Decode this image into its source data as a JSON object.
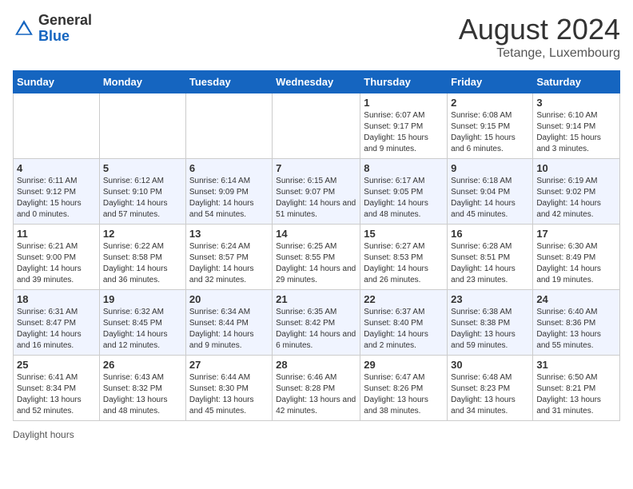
{
  "header": {
    "logo_general": "General",
    "logo_blue": "Blue",
    "month_title": "August 2024",
    "location": "Tetange, Luxembourg"
  },
  "footer": {
    "daylight_label": "Daylight hours"
  },
  "days_of_week": [
    "Sunday",
    "Monday",
    "Tuesday",
    "Wednesday",
    "Thursday",
    "Friday",
    "Saturday"
  ],
  "weeks": [
    [
      {
        "num": "",
        "info": ""
      },
      {
        "num": "",
        "info": ""
      },
      {
        "num": "",
        "info": ""
      },
      {
        "num": "",
        "info": ""
      },
      {
        "num": "1",
        "info": "Sunrise: 6:07 AM\nSunset: 9:17 PM\nDaylight: 15 hours and 9 minutes."
      },
      {
        "num": "2",
        "info": "Sunrise: 6:08 AM\nSunset: 9:15 PM\nDaylight: 15 hours and 6 minutes."
      },
      {
        "num": "3",
        "info": "Sunrise: 6:10 AM\nSunset: 9:14 PM\nDaylight: 15 hours and 3 minutes."
      }
    ],
    [
      {
        "num": "4",
        "info": "Sunrise: 6:11 AM\nSunset: 9:12 PM\nDaylight: 15 hours and 0 minutes."
      },
      {
        "num": "5",
        "info": "Sunrise: 6:12 AM\nSunset: 9:10 PM\nDaylight: 14 hours and 57 minutes."
      },
      {
        "num": "6",
        "info": "Sunrise: 6:14 AM\nSunset: 9:09 PM\nDaylight: 14 hours and 54 minutes."
      },
      {
        "num": "7",
        "info": "Sunrise: 6:15 AM\nSunset: 9:07 PM\nDaylight: 14 hours and 51 minutes."
      },
      {
        "num": "8",
        "info": "Sunrise: 6:17 AM\nSunset: 9:05 PM\nDaylight: 14 hours and 48 minutes."
      },
      {
        "num": "9",
        "info": "Sunrise: 6:18 AM\nSunset: 9:04 PM\nDaylight: 14 hours and 45 minutes."
      },
      {
        "num": "10",
        "info": "Sunrise: 6:19 AM\nSunset: 9:02 PM\nDaylight: 14 hours and 42 minutes."
      }
    ],
    [
      {
        "num": "11",
        "info": "Sunrise: 6:21 AM\nSunset: 9:00 PM\nDaylight: 14 hours and 39 minutes."
      },
      {
        "num": "12",
        "info": "Sunrise: 6:22 AM\nSunset: 8:58 PM\nDaylight: 14 hours and 36 minutes."
      },
      {
        "num": "13",
        "info": "Sunrise: 6:24 AM\nSunset: 8:57 PM\nDaylight: 14 hours and 32 minutes."
      },
      {
        "num": "14",
        "info": "Sunrise: 6:25 AM\nSunset: 8:55 PM\nDaylight: 14 hours and 29 minutes."
      },
      {
        "num": "15",
        "info": "Sunrise: 6:27 AM\nSunset: 8:53 PM\nDaylight: 14 hours and 26 minutes."
      },
      {
        "num": "16",
        "info": "Sunrise: 6:28 AM\nSunset: 8:51 PM\nDaylight: 14 hours and 23 minutes."
      },
      {
        "num": "17",
        "info": "Sunrise: 6:30 AM\nSunset: 8:49 PM\nDaylight: 14 hours and 19 minutes."
      }
    ],
    [
      {
        "num": "18",
        "info": "Sunrise: 6:31 AM\nSunset: 8:47 PM\nDaylight: 14 hours and 16 minutes."
      },
      {
        "num": "19",
        "info": "Sunrise: 6:32 AM\nSunset: 8:45 PM\nDaylight: 14 hours and 12 minutes."
      },
      {
        "num": "20",
        "info": "Sunrise: 6:34 AM\nSunset: 8:44 PM\nDaylight: 14 hours and 9 minutes."
      },
      {
        "num": "21",
        "info": "Sunrise: 6:35 AM\nSunset: 8:42 PM\nDaylight: 14 hours and 6 minutes."
      },
      {
        "num": "22",
        "info": "Sunrise: 6:37 AM\nSunset: 8:40 PM\nDaylight: 14 hours and 2 minutes."
      },
      {
        "num": "23",
        "info": "Sunrise: 6:38 AM\nSunset: 8:38 PM\nDaylight: 13 hours and 59 minutes."
      },
      {
        "num": "24",
        "info": "Sunrise: 6:40 AM\nSunset: 8:36 PM\nDaylight: 13 hours and 55 minutes."
      }
    ],
    [
      {
        "num": "25",
        "info": "Sunrise: 6:41 AM\nSunset: 8:34 PM\nDaylight: 13 hours and 52 minutes."
      },
      {
        "num": "26",
        "info": "Sunrise: 6:43 AM\nSunset: 8:32 PM\nDaylight: 13 hours and 48 minutes."
      },
      {
        "num": "27",
        "info": "Sunrise: 6:44 AM\nSunset: 8:30 PM\nDaylight: 13 hours and 45 minutes."
      },
      {
        "num": "28",
        "info": "Sunrise: 6:46 AM\nSunset: 8:28 PM\nDaylight: 13 hours and 42 minutes."
      },
      {
        "num": "29",
        "info": "Sunrise: 6:47 AM\nSunset: 8:26 PM\nDaylight: 13 hours and 38 minutes."
      },
      {
        "num": "30",
        "info": "Sunrise: 6:48 AM\nSunset: 8:23 PM\nDaylight: 13 hours and 34 minutes."
      },
      {
        "num": "31",
        "info": "Sunrise: 6:50 AM\nSunset: 8:21 PM\nDaylight: 13 hours and 31 minutes."
      }
    ]
  ]
}
